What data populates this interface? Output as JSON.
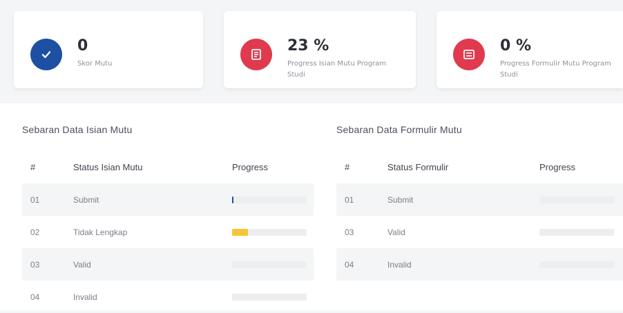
{
  "cards": [
    {
      "value": "0",
      "desc": "Skor Mutu"
    },
    {
      "value": "23 %",
      "desc": "Progress Isian Mutu Program Studi"
    },
    {
      "value": "0 %",
      "desc": "Progress Formulir Mutu Program Studi"
    }
  ],
  "colors": {
    "blue": "#1d4fa3",
    "red": "#e03a4e",
    "yellow": "#f6c435"
  },
  "icons": [
    "check-icon",
    "list-icon",
    "form-icon"
  ],
  "isian": {
    "title": "Sebaran Data Isian Mutu",
    "headers": [
      "#",
      "Status Isian Mutu",
      "Progress"
    ],
    "rows": [
      {
        "no": "01",
        "status": "Submit",
        "progress_fraction": 0.02
      },
      {
        "no": "02",
        "status": "Tidak Lengkap",
        "progress_fraction": 0.21
      },
      {
        "no": "03",
        "status": "Valid",
        "progress_fraction": 0
      },
      {
        "no": "04",
        "status": "Invalid",
        "progress_fraction": 0
      }
    ]
  },
  "formulir": {
    "title": "Sebaran Data Formulir Mutu",
    "headers": [
      "#",
      "Status Formulir",
      "Progress"
    ],
    "rows": [
      {
        "no": "01",
        "status": "Submit",
        "progress_fraction": 0
      },
      {
        "no": "03",
        "status": "Valid",
        "progress_fraction": 0
      },
      {
        "no": "04",
        "status": "Invalid",
        "progress_fraction": 0
      }
    ]
  }
}
